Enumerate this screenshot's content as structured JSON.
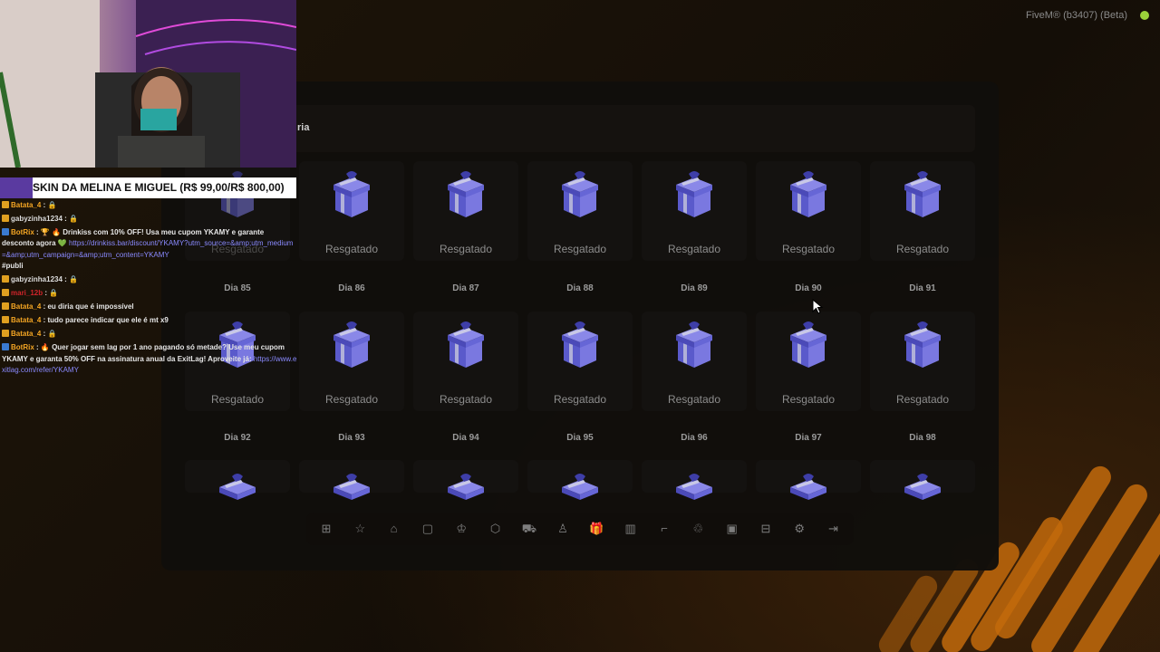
{
  "window": {
    "title": "FiveM® (b3407) (Beta)"
  },
  "stream": {
    "banner": "SKIN DA MELINA E MIGUEL (R$ 99,00/R$ 800,00)",
    "chat": [
      {
        "user": "Batata_4",
        "user_color": "#f5a623",
        "text": ": 🔒"
      },
      {
        "user": "gabyzinha1234",
        "user_color": "#dddddd",
        "text": ": 🔒"
      },
      {
        "user": "BotRix",
        "user_color": "#f5a623",
        "text": ": 🏆 🔥 Drinkiss com 10% OFF! Usa meu cupom YKAMY e garante desconto agora 💚",
        "link": "https://drinkiss.bar/discount/YKAMY?utm_source=&amp;utm_medium=&amp;utm_campaign=&amp;utm_content=YKAMY",
        "extra": "#publi"
      },
      {
        "user": "gabyzinha1234",
        "user_color": "#dddddd",
        "text": ": 🔒"
      },
      {
        "user": "mari_12b",
        "user_color": "#d0242a",
        "text": ": 🔒"
      },
      {
        "user": "Batata_4",
        "user_color": "#f5a623",
        "text": ": eu diria que é impossível"
      },
      {
        "user": "Batata_4",
        "user_color": "#f5a623",
        "text": ": tudo parece indicar que ele é mt x9"
      },
      {
        "user": "Batata_4",
        "user_color": "#f5a623",
        "text": ": 🔒"
      },
      {
        "user": "BotRix",
        "user_color": "#f5a623",
        "text": ": 🔥 Quer jogar sem lag por 1 ano pagando só metade? Use meu cupom YKAMY e garanta 50% OFF na assinatura anual da ExitLag! Aproveite já:",
        "link": "https://www.exitlag.com/refer/YKAMY"
      }
    ]
  },
  "rewards": {
    "title_fragment": "ria",
    "status_label": "Resgatado",
    "rows": [
      {
        "days": [
          "",
          "",
          "",
          "",
          "",
          "",
          ""
        ],
        "status": true
      },
      {
        "days": [
          "Dia 85",
          "Dia 86",
          "Dia 87",
          "Dia 88",
          "Dia 89",
          "Dia 90",
          "Dia 91"
        ],
        "status": true
      },
      {
        "days": [
          "Dia 92",
          "Dia 93",
          "Dia 94",
          "Dia 95",
          "Dia 96",
          "Dia 97",
          "Dia 98"
        ],
        "status": false
      }
    ]
  },
  "dock": {
    "icons": [
      "grid-icon",
      "star-icon",
      "home-icon",
      "clipboard-icon",
      "crown-icon",
      "cube-icon",
      "cart-icon",
      "podium-icon",
      "gift-icon",
      "barcode-icon",
      "gun-icon",
      "recycle-icon",
      "calendar-icon",
      "map-icon",
      "settings-icon",
      "logout-icon"
    ],
    "active_index": 8,
    "accent": "#f08a1a"
  }
}
